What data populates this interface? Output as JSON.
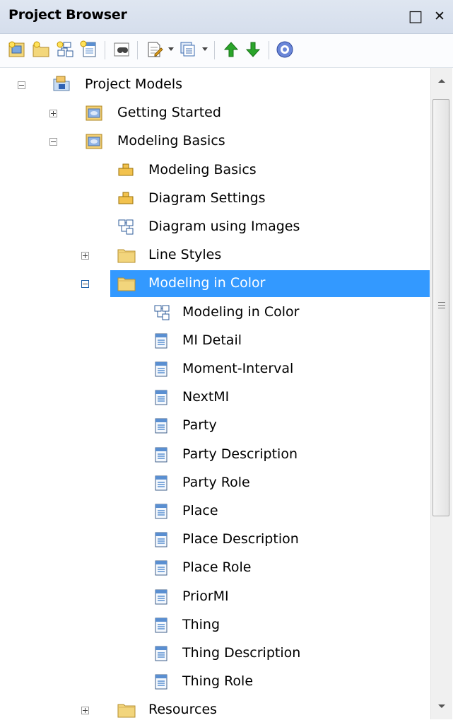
{
  "window": {
    "title": "Project Browser",
    "restore_glyph": "□",
    "close_glyph": "✕"
  },
  "toolbar": {
    "icons": [
      "new-package-icon",
      "new-view-icon",
      "new-diagram-icon",
      "new-element-icon",
      "find-icon",
      "document-icon",
      "reports-icon",
      "move-up-icon",
      "move-down-icon",
      "help-icon"
    ]
  },
  "colors": {
    "selection": "#3399ff",
    "folder": "#f2d57c",
    "class": "#5a8fd1",
    "up_arrow": "#2aa52a",
    "down_arrow": "#2aa52a"
  },
  "tree": [
    {
      "label": "Project Models",
      "level": 0,
      "expander": "minus",
      "icon": "model-root-icon",
      "selected": false
    },
    {
      "label": "Getting Started",
      "level": 1,
      "expander": "plus",
      "icon": "model-package-icon",
      "selected": false
    },
    {
      "label": "Modeling Basics",
      "level": 1,
      "expander": "minus",
      "icon": "model-package-icon",
      "selected": false
    },
    {
      "label": "Modeling Basics",
      "level": 2,
      "expander": "",
      "icon": "package-diagram-icon",
      "selected": false
    },
    {
      "label": "Diagram Settings",
      "level": 2,
      "expander": "",
      "icon": "package-diagram-icon",
      "selected": false
    },
    {
      "label": "Diagram using Images",
      "level": 2,
      "expander": "",
      "icon": "class-diagram-icon",
      "selected": false
    },
    {
      "label": "Line Styles",
      "level": 2,
      "expander": "plus",
      "icon": "folder-icon",
      "selected": false
    },
    {
      "label": "Modeling in Color",
      "level": 2,
      "expander": "minus",
      "icon": "folder-icon",
      "selected": true
    },
    {
      "label": "Modeling in Color",
      "level": 3,
      "expander": "",
      "icon": "class-diagram-icon",
      "selected": false
    },
    {
      "label": "MI Detail",
      "level": 3,
      "expander": "",
      "icon": "class-element-icon",
      "selected": false
    },
    {
      "label": "Moment-Interval",
      "level": 3,
      "expander": "",
      "icon": "class-element-icon",
      "selected": false
    },
    {
      "label": "NextMI",
      "level": 3,
      "expander": "",
      "icon": "class-element-icon",
      "selected": false
    },
    {
      "label": "Party",
      "level": 3,
      "expander": "",
      "icon": "class-element-icon",
      "selected": false
    },
    {
      "label": "Party Description",
      "level": 3,
      "expander": "",
      "icon": "class-element-icon",
      "selected": false
    },
    {
      "label": "Party Role",
      "level": 3,
      "expander": "",
      "icon": "class-element-icon",
      "selected": false
    },
    {
      "label": "Place",
      "level": 3,
      "expander": "",
      "icon": "class-element-icon",
      "selected": false
    },
    {
      "label": "Place Description",
      "level": 3,
      "expander": "",
      "icon": "class-element-icon",
      "selected": false
    },
    {
      "label": "Place Role",
      "level": 3,
      "expander": "",
      "icon": "class-element-icon",
      "selected": false
    },
    {
      "label": "PriorMI",
      "level": 3,
      "expander": "",
      "icon": "class-element-icon",
      "selected": false
    },
    {
      "label": "Thing",
      "level": 3,
      "expander": "",
      "icon": "class-element-icon",
      "selected": false
    },
    {
      "label": "Thing Description",
      "level": 3,
      "expander": "",
      "icon": "class-element-icon",
      "selected": false
    },
    {
      "label": "Thing Role",
      "level": 3,
      "expander": "",
      "icon": "class-element-icon",
      "selected": false
    },
    {
      "label": "Resources",
      "level": 2,
      "expander": "plus",
      "icon": "folder-icon",
      "selected": false
    }
  ]
}
